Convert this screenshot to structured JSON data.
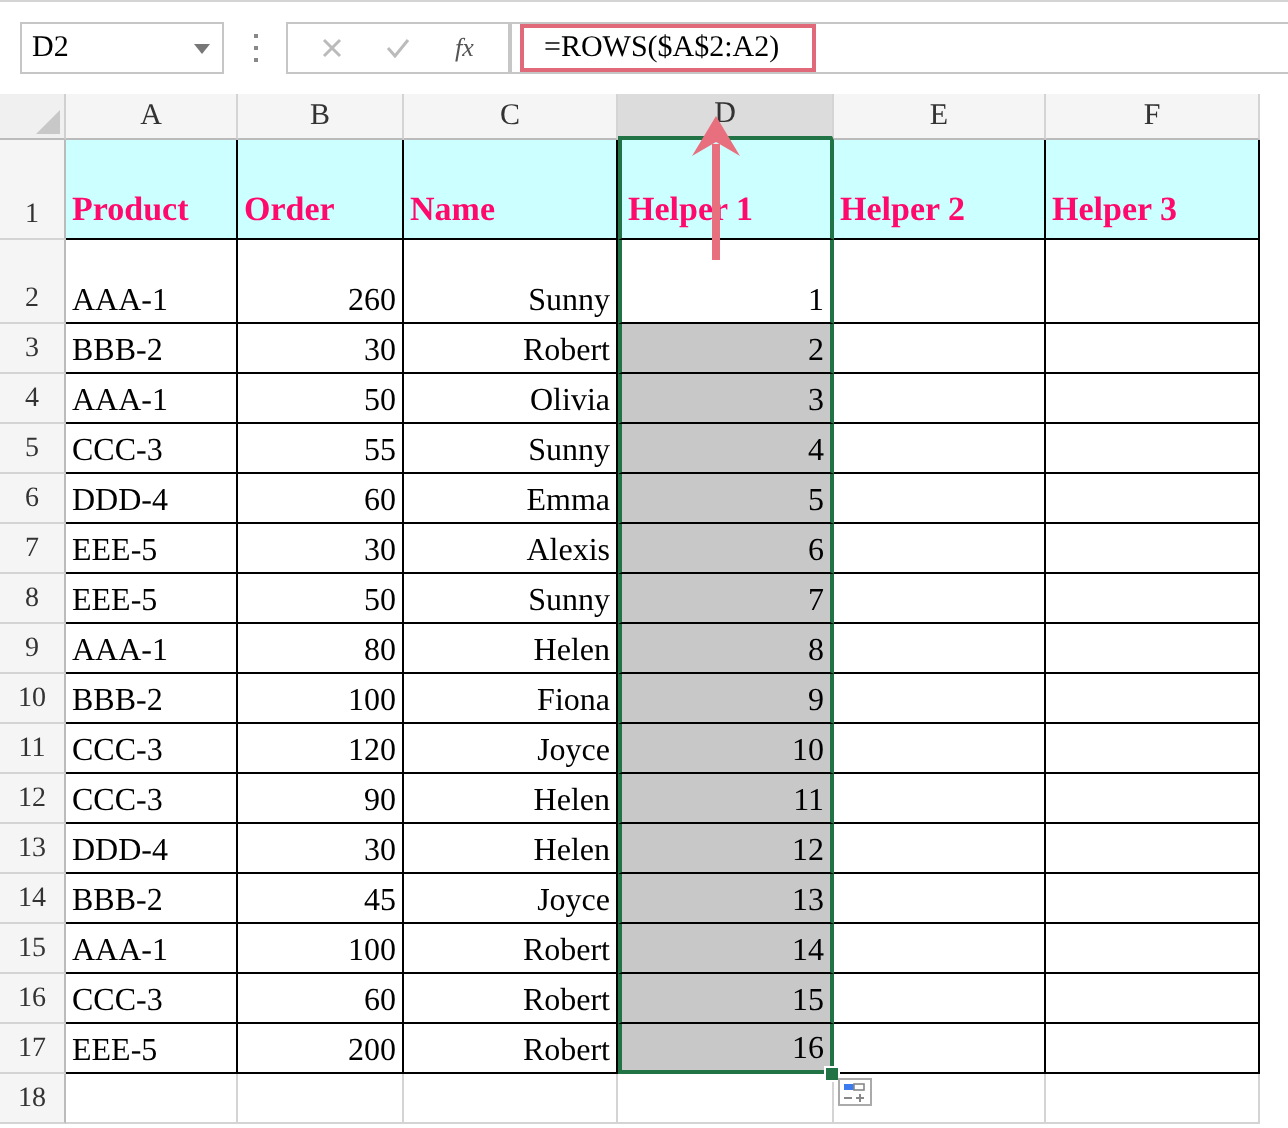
{
  "name_box": "D2",
  "fx_label": "fx",
  "formula": "=ROWS($A$2:A2)",
  "columns": [
    {
      "label": "A",
      "selected": false
    },
    {
      "label": "B",
      "selected": false
    },
    {
      "label": "C",
      "selected": false
    },
    {
      "label": "D",
      "selected": true
    },
    {
      "label": "E",
      "selected": false
    },
    {
      "label": "F",
      "selected": false
    }
  ],
  "header_row": {
    "number": "1",
    "cells": [
      "Product",
      "Order",
      "Name",
      "Helper 1",
      "Helper 2",
      "Helper 3"
    ]
  },
  "rows": [
    {
      "number": "2",
      "product": "AAA-1",
      "order": "260",
      "name": "Sunny",
      "helper": "1",
      "highlighted": false
    },
    {
      "number": "3",
      "product": "BBB-2",
      "order": "30",
      "name": "Robert",
      "helper": "2",
      "highlighted": true
    },
    {
      "number": "4",
      "product": "AAA-1",
      "order": "50",
      "name": "Olivia",
      "helper": "3",
      "highlighted": true
    },
    {
      "number": "5",
      "product": "CCC-3",
      "order": "55",
      "name": "Sunny",
      "helper": "4",
      "highlighted": true
    },
    {
      "number": "6",
      "product": "DDD-4",
      "order": "60",
      "name": "Emma",
      "helper": "5",
      "highlighted": true
    },
    {
      "number": "7",
      "product": "EEE-5",
      "order": "30",
      "name": "Alexis",
      "helper": "6",
      "highlighted": true
    },
    {
      "number": "8",
      "product": "EEE-5",
      "order": "50",
      "name": "Sunny",
      "helper": "7",
      "highlighted": true
    },
    {
      "number": "9",
      "product": "AAA-1",
      "order": "80",
      "name": "Helen",
      "helper": "8",
      "highlighted": true
    },
    {
      "number": "10",
      "product": "BBB-2",
      "order": "100",
      "name": "Fiona",
      "helper": "9",
      "highlighted": true
    },
    {
      "number": "11",
      "product": "CCC-3",
      "order": "120",
      "name": "Joyce",
      "helper": "10",
      "highlighted": true
    },
    {
      "number": "12",
      "product": "CCC-3",
      "order": "90",
      "name": "Helen",
      "helper": "11",
      "highlighted": true
    },
    {
      "number": "13",
      "product": "DDD-4",
      "order": "30",
      "name": "Helen",
      "helper": "12",
      "highlighted": true
    },
    {
      "number": "14",
      "product": "BBB-2",
      "order": "45",
      "name": "Joyce",
      "helper": "13",
      "highlighted": true
    },
    {
      "number": "15",
      "product": "AAA-1",
      "order": "100",
      "name": "Robert",
      "helper": "14",
      "highlighted": true
    },
    {
      "number": "16",
      "product": "CCC-3",
      "order": "60",
      "name": "Robert",
      "helper": "15",
      "highlighted": true
    },
    {
      "number": "17",
      "product": "EEE-5",
      "order": "200",
      "name": "Robert",
      "helper": "16",
      "highlighted": true
    }
  ],
  "empty_rows": [
    "18"
  ]
}
